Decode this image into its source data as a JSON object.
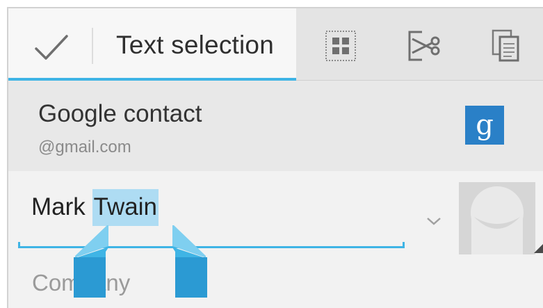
{
  "action_bar": {
    "title": "Text selection",
    "done_icon": "checkmark-icon",
    "actions": [
      {
        "name": "select-all",
        "icon": "select-all-icon"
      },
      {
        "name": "cut",
        "icon": "cut-icon"
      },
      {
        "name": "copy",
        "icon": "copy-icon"
      }
    ],
    "accent_color": "#3fb4e5"
  },
  "account": {
    "name": "Google contact",
    "email": "@gmail.com",
    "logo_letter": "g",
    "logo_color": "#2a80c7"
  },
  "name_field": {
    "before_selection": "Mark ",
    "selected_text": "Twain",
    "selection_color": "#aedcf3"
  },
  "company_field": {
    "placeholder": "Company"
  }
}
